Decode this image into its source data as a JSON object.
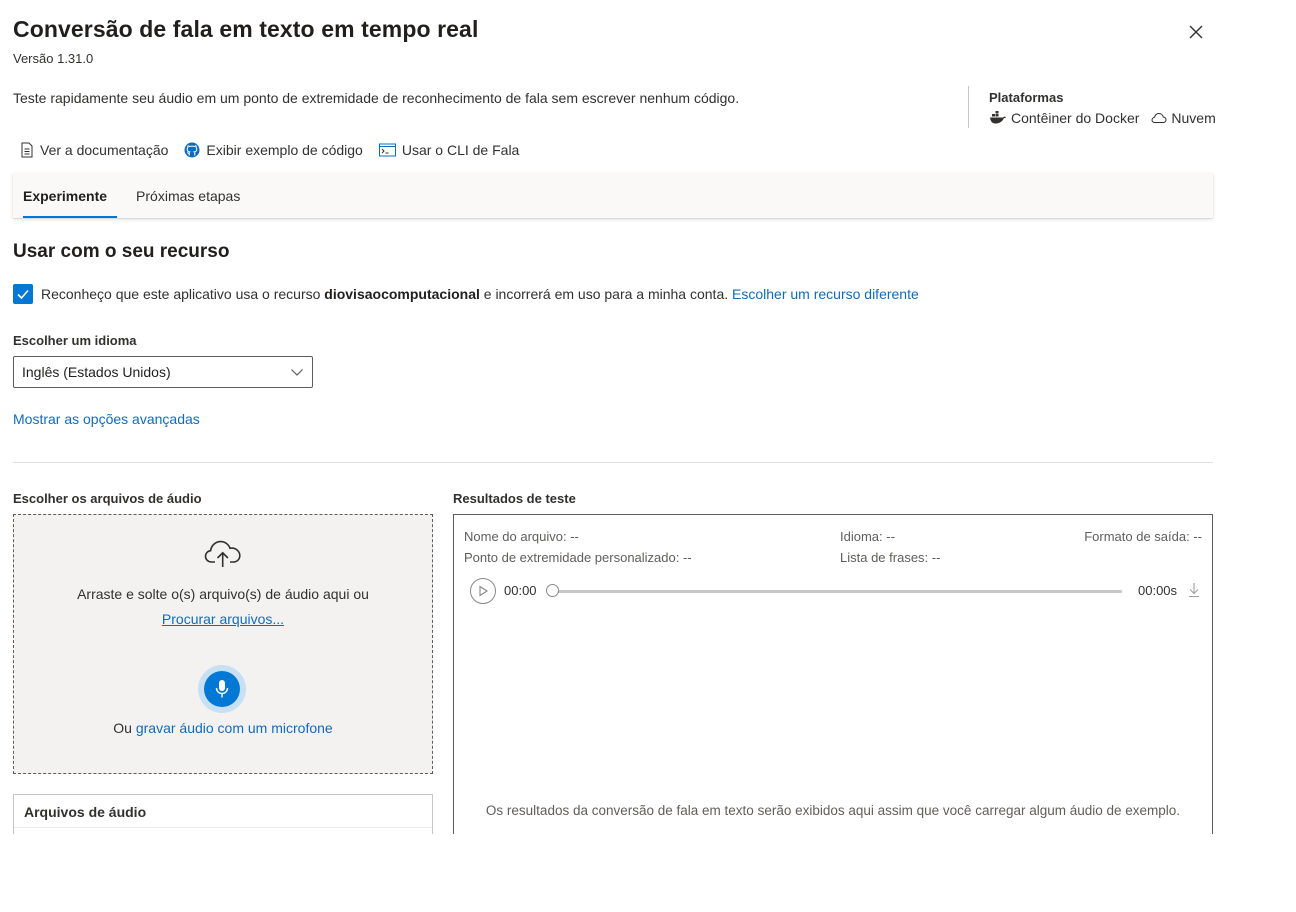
{
  "header": {
    "title": "Conversão de fala em texto em tempo real",
    "version": "Versão 1.31.0",
    "description": "Teste rapidamente seu áudio em um ponto de extremidade de reconhecimento de fala sem escrever nenhum código."
  },
  "platforms": {
    "title": "Plataformas",
    "items": [
      {
        "label": "Contêiner do Docker",
        "icon": "docker-icon"
      },
      {
        "label": "Nuvem",
        "icon": "cloud-icon"
      }
    ]
  },
  "links": [
    {
      "label": "Ver a documentação",
      "icon": "document-icon"
    },
    {
      "label": "Exibir exemplo de código",
      "icon": "github-icon"
    },
    {
      "label": "Usar o CLI de Fala",
      "icon": "terminal-icon"
    }
  ],
  "tabs": [
    {
      "label": "Experimente",
      "active": true
    },
    {
      "label": "Próximas etapas",
      "active": false
    }
  ],
  "resource": {
    "section_title": "Usar com o seu recurso",
    "ack_prefix": "Reconheço que este aplicativo usa o recurso ",
    "resource_name": "diovisaocomputacional",
    "ack_suffix": " e incorrerá em uso para a minha conta. ",
    "choose_link": "Escolher um recurso diferente",
    "checked": true
  },
  "language": {
    "label": "Escolher um idioma",
    "selected": "Inglês (Estados Unidos)",
    "advanced_link": "Mostrar as opções avançadas"
  },
  "upload": {
    "label": "Escolher os arquivos de áudio",
    "drop_text": "Arraste e solte o(s) arquivo(s) de áudio aqui ou",
    "browse_link": "Procurar arquivos...",
    "record_prefix": "Ou ",
    "record_link": "gravar áudio com um microfone",
    "audio_files_title": "Arquivos de áudio"
  },
  "results": {
    "label": "Resultados de teste",
    "file_name": "Nome do arquivo: --",
    "language": "Idioma: --",
    "output_format": "Formato de saída: --",
    "custom_endpoint": "Ponto de extremidade personalizado: --",
    "phrase_list": "Lista de frases: --",
    "time_start": "00:00",
    "time_end": "00:00s",
    "progress": 0,
    "empty_message": "Os resultados da conversão de fala em texto serão exibidos aqui assim que você carregar algum áudio de exemplo."
  },
  "colors": {
    "accent": "#0078d4",
    "link": "#0f6cbd",
    "mic_ring": "#c7e0f4",
    "dropzone_bg": "#f3f2f1",
    "tab_bar_bg": "#faf9f8"
  }
}
